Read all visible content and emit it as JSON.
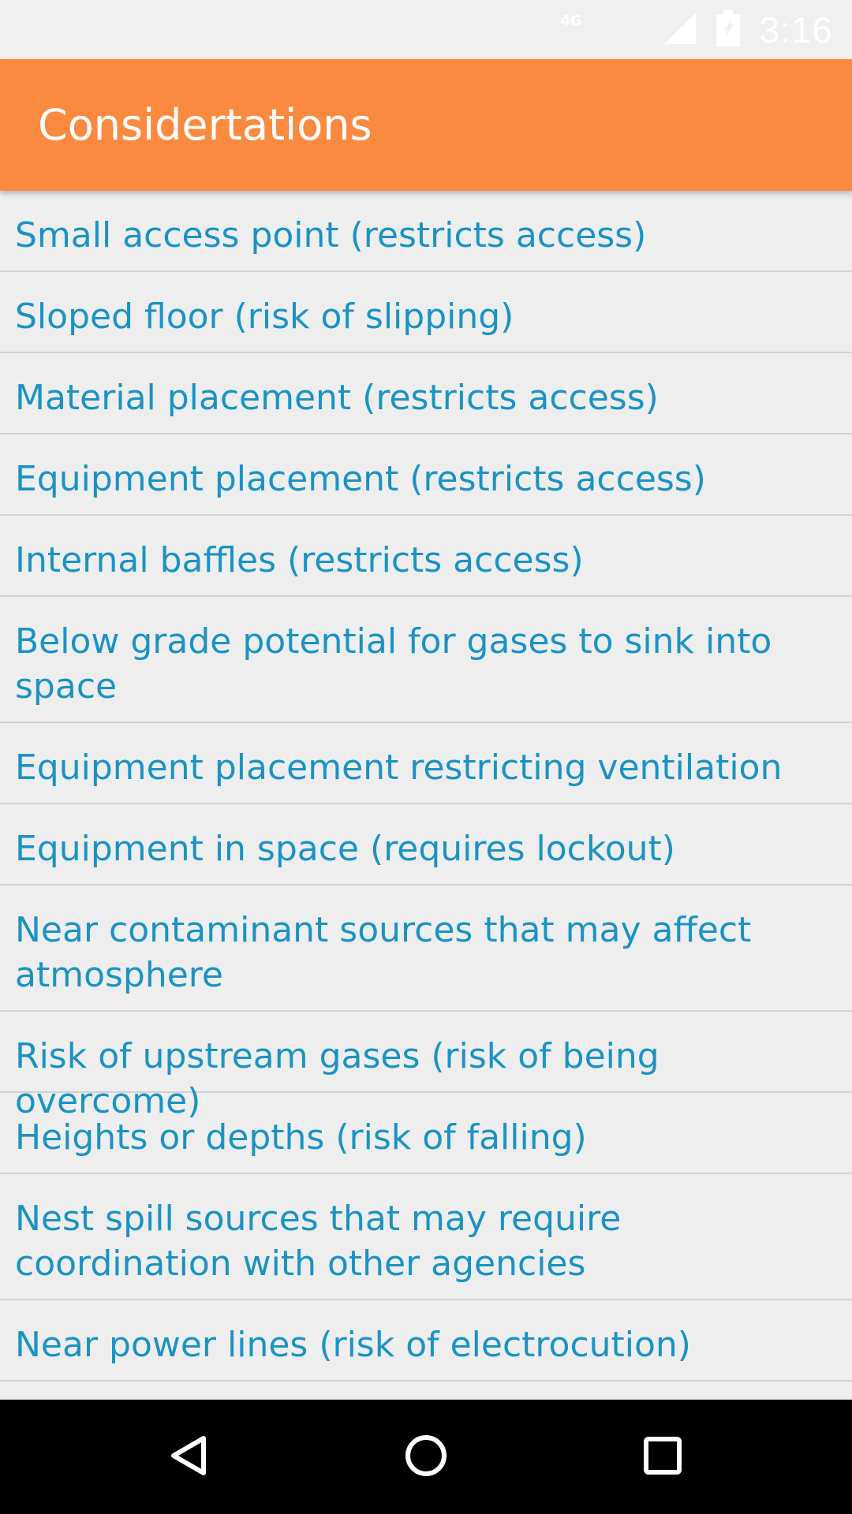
{
  "status_bar": {
    "network": "4G",
    "time": "3:16",
    "icons": [
      "signal-icon",
      "battery-icon"
    ]
  },
  "app_bar": {
    "title": "Considertations"
  },
  "list": {
    "items": [
      {
        "label": "Small access point (restricts access)"
      },
      {
        "label": "Sloped floor (risk of slipping)"
      },
      {
        "label": "Material placement (restricts access)"
      },
      {
        "label": "Equipment placement (restricts access)"
      },
      {
        "label": "Internal baffles (restricts access)"
      },
      {
        "label": "Below grade potential for gases to sink into space"
      },
      {
        "label": "Equipment placement restricting ventilation"
      },
      {
        "label": "Equipment in space (requires lockout)"
      },
      {
        "label": "Near contaminant sources that may affect atmosphere"
      },
      {
        "label": "Risk of upstream gases (risk of being overcome)"
      },
      {
        "label": "Heights or depths (risk of falling)"
      },
      {
        "label": "Nest spill sources that may require coordination with other agencies"
      },
      {
        "label": "Near power lines (risk of electrocution)"
      }
    ]
  },
  "nav_bar": {
    "buttons": [
      "back-icon",
      "home-icon",
      "recents-icon"
    ]
  },
  "colors": {
    "app_bar": "#fa8a3f",
    "list_text": "#1a93c3",
    "background": "#eeeeee",
    "divider": "#d2d2d2",
    "nav_bar": "#000000"
  }
}
